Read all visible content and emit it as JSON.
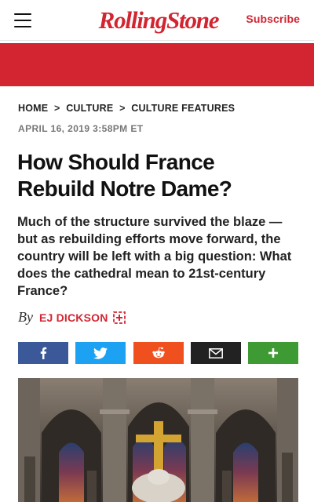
{
  "header": {
    "logo_text": "RollingStone",
    "subscribe_label": "Subscribe"
  },
  "breadcrumb": {
    "items": [
      "HOME",
      "CULTURE",
      "CULTURE FEATURES"
    ],
    "separator": ">"
  },
  "article": {
    "date": "APRIL 16, 2019 3:58PM ET",
    "title": "How Should France Rebuild Notre Dame?",
    "dek": "Much of the structure survived the blaze — but as rebuilding efforts move forward, the country will be left with a big question: What does the cathedral mean to 21st-century France?",
    "by_label": "By",
    "author": "EJ DICKSON"
  },
  "share_buttons": [
    {
      "name": "facebook",
      "icon": "facebook-icon",
      "color": "#3b5998"
    },
    {
      "name": "twitter",
      "icon": "twitter-icon",
      "color": "#1da1f2"
    },
    {
      "name": "reddit",
      "icon": "reddit-icon",
      "color": "#f04f1e"
    },
    {
      "name": "email",
      "icon": "email-icon",
      "color": "#222222"
    },
    {
      "name": "more",
      "icon": "plus-icon",
      "color": "#3e9a33"
    }
  ],
  "colors": {
    "brand_red": "#d32531"
  }
}
